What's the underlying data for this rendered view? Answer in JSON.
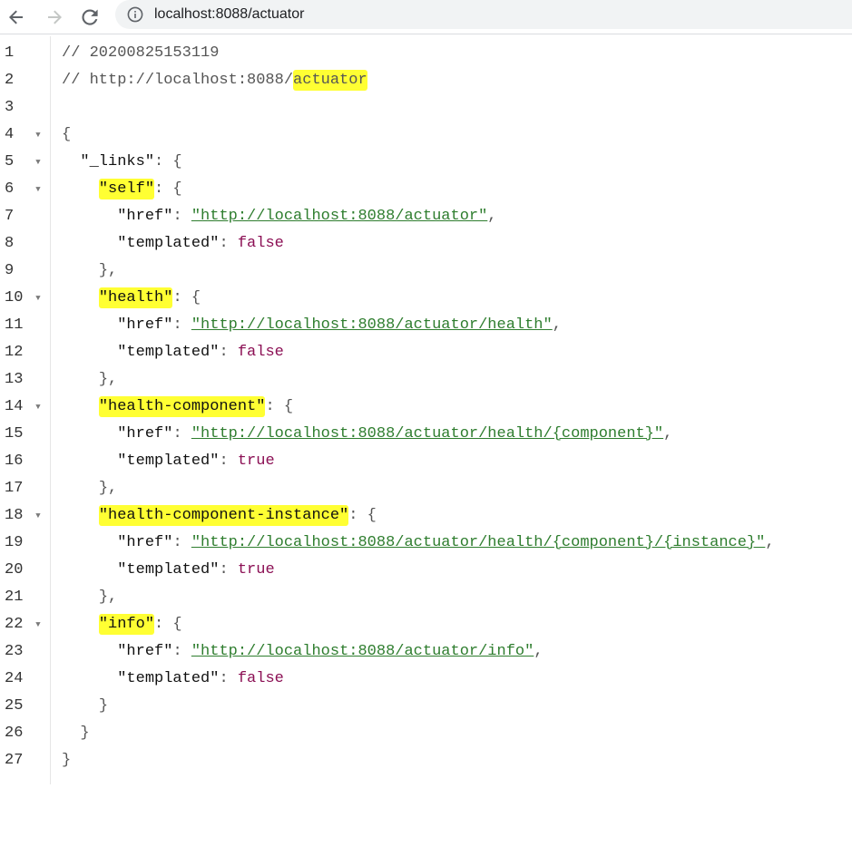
{
  "browser": {
    "url": "localhost:8088/actuator",
    "icons": {
      "back": "arrow-left-icon",
      "forward": "arrow-right-icon",
      "reload": "reload-icon",
      "site_info": "info-icon"
    }
  },
  "viewer": {
    "line_numbers": [
      "1",
      "2",
      "3",
      "4",
      "5",
      "6",
      "7",
      "8",
      "9",
      "10",
      "11",
      "12",
      "13",
      "14",
      "15",
      "16",
      "17",
      "18",
      "19",
      "20",
      "21",
      "22",
      "23",
      "24",
      "25",
      "26",
      "27"
    ],
    "comment_timestamp": "// 20200825153119",
    "comment_url_prefix": "// http://localhost:8088/",
    "comment_url_highlight": "actuator",
    "open_brace": "{",
    "close_brace": "}",
    "links_key": "\"_links\"",
    "colon_brace": ": {",
    "colon": ": ",
    "comma": ",",
    "object_close": "}",
    "object_close_comma": "},",
    "href_key": "\"href\"",
    "templated_key": "\"templated\"",
    "entries": [
      {
        "key": "\"self\"",
        "href": "\"http://localhost:8088/actuator\"",
        "templated": "false"
      },
      {
        "key": "\"health\"",
        "href": "\"http://localhost:8088/actuator/health\"",
        "templated": "false"
      },
      {
        "key": "\"health-component\"",
        "href": "\"http://localhost:8088/actuator/health/{component}\"",
        "templated": "true"
      },
      {
        "key": "\"health-component-instance\"",
        "href": "\"http://localhost:8088/actuator/health/{component}/{instance}\"",
        "templated": "true"
      },
      {
        "key": "\"info\"",
        "href": "\"http://localhost:8088/actuator/info\"",
        "templated": "false"
      }
    ],
    "colors": {
      "highlight": "#ffff33",
      "link": "#2e7d2e",
      "boolean": "#8b0f54"
    }
  }
}
